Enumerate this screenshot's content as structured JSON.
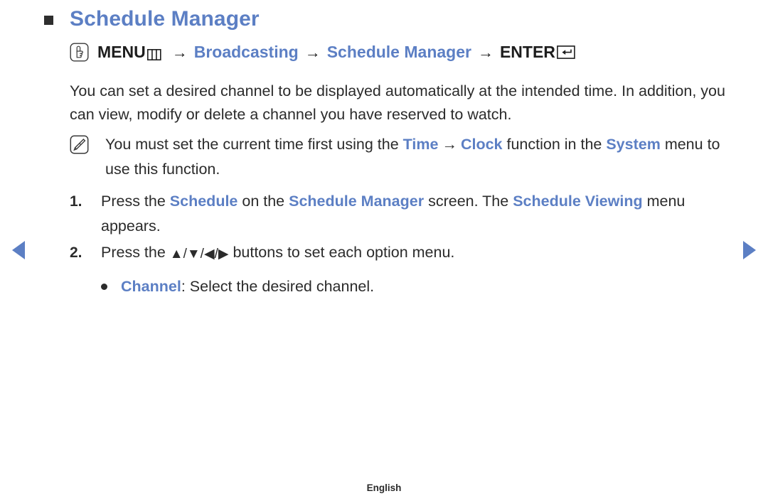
{
  "heading": {
    "bullet_icon": "filled-square-icon",
    "title": "Schedule Manager"
  },
  "menu_path": {
    "icon": "hand-press-button-icon",
    "menu_label": "MENU",
    "menu_glyph": "menu-bars-icon",
    "arrow_1": "→",
    "broadcasting_label": "Broadcasting",
    "arrow_2": "→",
    "schedule_manager_label": "Schedule Manager",
    "arrow_3": "→",
    "enter_label": "ENTER",
    "enter_glyph": "enter-return-key-icon"
  },
  "intro": {
    "text": "You can set a desired channel to be displayed automatically at the intended time. In addition, you can view, modify or delete a channel you have reserved to watch."
  },
  "note": {
    "icon": "note-pencil-icon",
    "part_1": "You must set the current time first using the ",
    "time_label": "Time",
    "arrow": "→",
    "clock_label": "Clock",
    "part_2": " function in the ",
    "system_label": "System",
    "part_3": " menu to use this function."
  },
  "steps": [
    {
      "number": "1.",
      "part_1": "Press the ",
      "schedule_label": "Schedule",
      "part_2": " on the ",
      "schedule_manager_label": "Schedule Manager",
      "part_3": " screen. The ",
      "schedule_viewing_label": "Schedule Viewing",
      "part_4": " menu appears."
    },
    {
      "number": "2.",
      "part_1": "Press the ",
      "direction_glyphs": "▲/▼/◀/▶",
      "part_2": " buttons to set each option menu."
    }
  ],
  "bullet": {
    "marker": "bullet-dot-icon",
    "label": "Channel",
    "description": ": Select the desired channel."
  },
  "navigation": {
    "prev_icon": "left-triangle-icon",
    "next_icon": "right-triangle-icon"
  },
  "footer": {
    "language": "English"
  },
  "colors": {
    "accent_blue": "#5c7fc4",
    "body_text": "#2b2b2b",
    "background": "#ffffff"
  }
}
